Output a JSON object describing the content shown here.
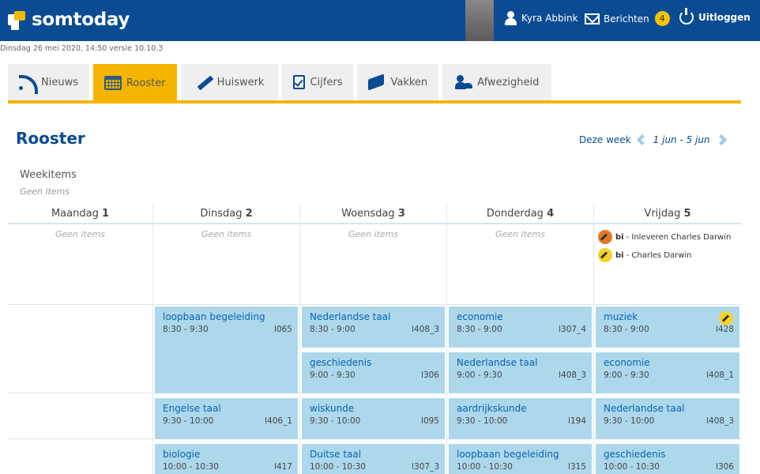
{
  "header": {
    "logo": "somtoday",
    "user_name": "Kyra Abbink",
    "messages_label": "Berichten",
    "messages_count": "4",
    "logout_label": "Uitloggen"
  },
  "datebar": "Dinsdag 26 mei 2020, 14:50 versie 10.10.3",
  "tabs": [
    {
      "label": "Nieuws",
      "icon": "feed-icon",
      "active": false
    },
    {
      "label": "Rooster",
      "icon": "calendar-icon",
      "active": true
    },
    {
      "label": "Huiswerk",
      "icon": "pencil-icon",
      "active": false
    },
    {
      "label": "Cijfers",
      "icon": "check-doc-icon",
      "active": false
    },
    {
      "label": "Vakken",
      "icon": "books-icon",
      "active": false
    },
    {
      "label": "Afwezigheid",
      "icon": "absence-icon",
      "active": false
    }
  ],
  "page": {
    "title": "Rooster",
    "week_label": "Deze week",
    "week_range": "1 jun - 5 jun",
    "weekitems_title": "Weekitems",
    "weekitems_empty": "Geen items"
  },
  "days": [
    {
      "name": "Maandag",
      "num": "1",
      "items_empty": "Geen items"
    },
    {
      "name": "Dinsdag",
      "num": "2",
      "items_empty": "Geen items"
    },
    {
      "name": "Woensdag",
      "num": "3",
      "items_empty": "Geen items"
    },
    {
      "name": "Donderdag",
      "num": "4",
      "items_empty": "Geen items"
    },
    {
      "name": "Vrijdag",
      "num": "5",
      "items_empty": ""
    }
  ],
  "friday_items": [
    {
      "subject": "bi",
      "text": "Inleveren Charles Darwin",
      "color": "#e07a24"
    },
    {
      "subject": "bi",
      "text": "Charles Darwin",
      "color": "#f5d22a"
    }
  ],
  "lessons": {
    "tue": [
      {
        "subject": "loopbaan begeleiding",
        "time": "8:30 - 9:30",
        "room": "l065"
      },
      {
        "subject": "Engelse taal",
        "time": "9:30 - 10:00",
        "room": "l406_1"
      },
      {
        "subject": "biologie",
        "time": "10:00 - 10:30",
        "room": "l417"
      }
    ],
    "wed": [
      {
        "subject": "Nederlandse taal",
        "time": "8:30 - 9:00",
        "room": "l408_3"
      },
      {
        "subject": "geschiedenis",
        "time": "9:00 - 9:30",
        "room": "l306"
      },
      {
        "subject": "wiskunde",
        "time": "9:30 - 10:00",
        "room": "l095"
      },
      {
        "subject": "Duitse taal",
        "time": "10:00 - 10:30",
        "room": "l307_3"
      }
    ],
    "thu": [
      {
        "subject": "economie",
        "time": "8:30 - 9:00",
        "room": "l307_4"
      },
      {
        "subject": "Nederlandse taal",
        "time": "9:00 - 9:30",
        "room": "l408_3"
      },
      {
        "subject": "aardrijkskunde",
        "time": "9:30 - 10:00",
        "room": "l194"
      },
      {
        "subject": "loopbaan begeleiding",
        "time": "10:00 - 10:30",
        "room": "l315"
      }
    ],
    "fri": [
      {
        "subject": "muziek",
        "time": "8:30 - 9:00",
        "room": "l428"
      },
      {
        "subject": "economie",
        "time": "9:00 - 9:30",
        "room": "l408_1"
      },
      {
        "subject": "Nederlandse taal",
        "time": "9:30 - 10:00",
        "room": "l408_3"
      },
      {
        "subject": "geschiedenis",
        "time": "10:00 - 10:30",
        "room": "l306"
      }
    ]
  }
}
